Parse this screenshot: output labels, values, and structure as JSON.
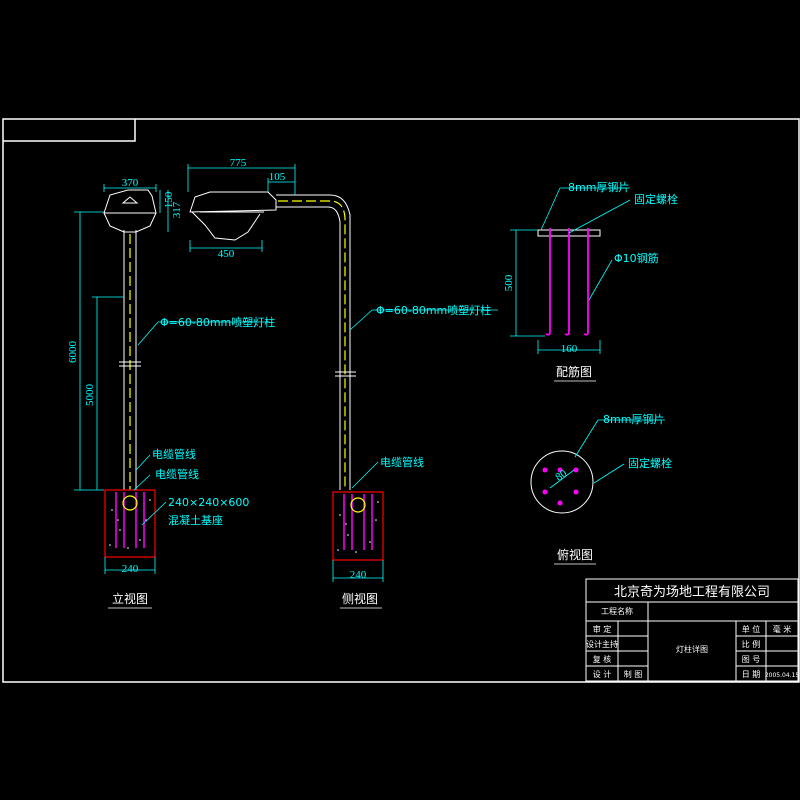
{
  "drawing": {
    "colors": {
      "background": "#000000",
      "frame": "#ffffff",
      "dimension": "#00ffff",
      "rebar": "#ff00ff",
      "pole": "#ffff00",
      "foundation": "#ff0000"
    },
    "front_view": {
      "title": "立视图",
      "dim_lamp_width": "370",
      "dim_lamp_height_a": "150",
      "dim_lamp_height_b": "317",
      "dim_total_height": "6000",
      "dim_pole_height": "5000",
      "pole_label": "Φ=60-80mm喷塑灯柱",
      "cable_label_1": "电缆管线",
      "cable_label_2": "电缆管线",
      "base_size_label": "240×240×600",
      "base_material_label": "混凝土基座",
      "dim_base_width": "240"
    },
    "side_view": {
      "title": "侧视图",
      "dim_arm_length": "775",
      "dim_arm_offset": "105",
      "dim_lamp_width": "450",
      "pole_label": "Φ=60-80mm喷塑灯柱",
      "cable_label": "电缆管线",
      "dim_base_width": "240"
    },
    "rebar_view": {
      "title": "配筋图",
      "plate_label": "8mm厚钢片",
      "bolt_label": "固定螺栓",
      "rebar_label": "Φ10钢筋",
      "dim_height": "500",
      "dim_width": "160"
    },
    "top_view": {
      "title": "俯视图",
      "plate_label": "8mm厚钢片",
      "bolt_label": "固定螺栓",
      "dim_center": "80"
    }
  },
  "title_block": {
    "company": "北京奇为场地工程有限公司",
    "project_label": "工程名称",
    "review_label": "审 定",
    "design_lead_label": "设计主持",
    "check_label": "复 核",
    "design_label": "设 计",
    "draw_label": "制 图",
    "drawing_name": "灯柱详图",
    "unit_label": "单 位",
    "unit_value": "毫 米",
    "scale_label": "比 例",
    "number_label": "图 号",
    "date_label": "日 期",
    "date_value": "2005.04.15"
  }
}
